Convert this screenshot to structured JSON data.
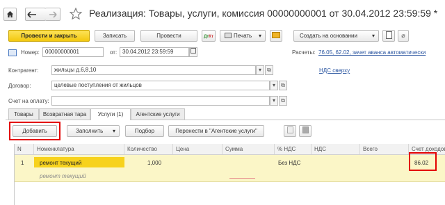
{
  "nav": {
    "home_icon": "home-icon",
    "back_icon": "arrow-left-icon",
    "forward_icon": "arrow-right-icon",
    "favorite_icon": "star-icon"
  },
  "title": "Реализация: Товары, услуги, комиссия 00000000001 от 30.04.2012 23:59:59 *",
  "toolbar": {
    "post_close": "Провести и закрыть",
    "save": "Записать",
    "post": "Провести",
    "print": "Печать",
    "create_based": "Создать на основании"
  },
  "header": {
    "number_label": "Номер:",
    "number_value": "00000000001",
    "from_label": "от:",
    "date_value": "30.04.2012 23:59:59",
    "calc_label": "Расчеты:",
    "calc_link": "76.05, 62.02, зачет аванса автоматически",
    "counterparty_label": "Контрагент:",
    "counterparty_value": "жильцы д.6,8,10",
    "vat_link": "НДС сверху",
    "contract_label": "Договор:",
    "contract_value": "целевые поступления от жильцов",
    "invoice_label": "Счет на оплату:",
    "invoice_value": ""
  },
  "tabs": [
    {
      "label": "Товары"
    },
    {
      "label": "Возвратная тара"
    },
    {
      "label": "Услуги (1)"
    },
    {
      "label": "Агентские услуги"
    }
  ],
  "table_toolbar": {
    "add": "Добавить",
    "fill": "Заполнить",
    "select": "Подбор",
    "transfer": "Перенести в \"Агентские услуги\""
  },
  "columns": [
    "N",
    "Номенклатура",
    "Количество",
    "Цена",
    "Сумма",
    "% НДС",
    "НДС",
    "Всего",
    "Счет доходов"
  ],
  "row": {
    "n": "1",
    "item": "ремонт текущий",
    "item_sub": "ремонт текущий",
    "qty": "1,000",
    "vat_rate": "Без НДС",
    "account": "86.02"
  },
  "colors": {
    "accent": "#f7d21d",
    "row_bg": "#fbf6c7",
    "highlight": "#e30000",
    "link": "#2a55a0"
  }
}
